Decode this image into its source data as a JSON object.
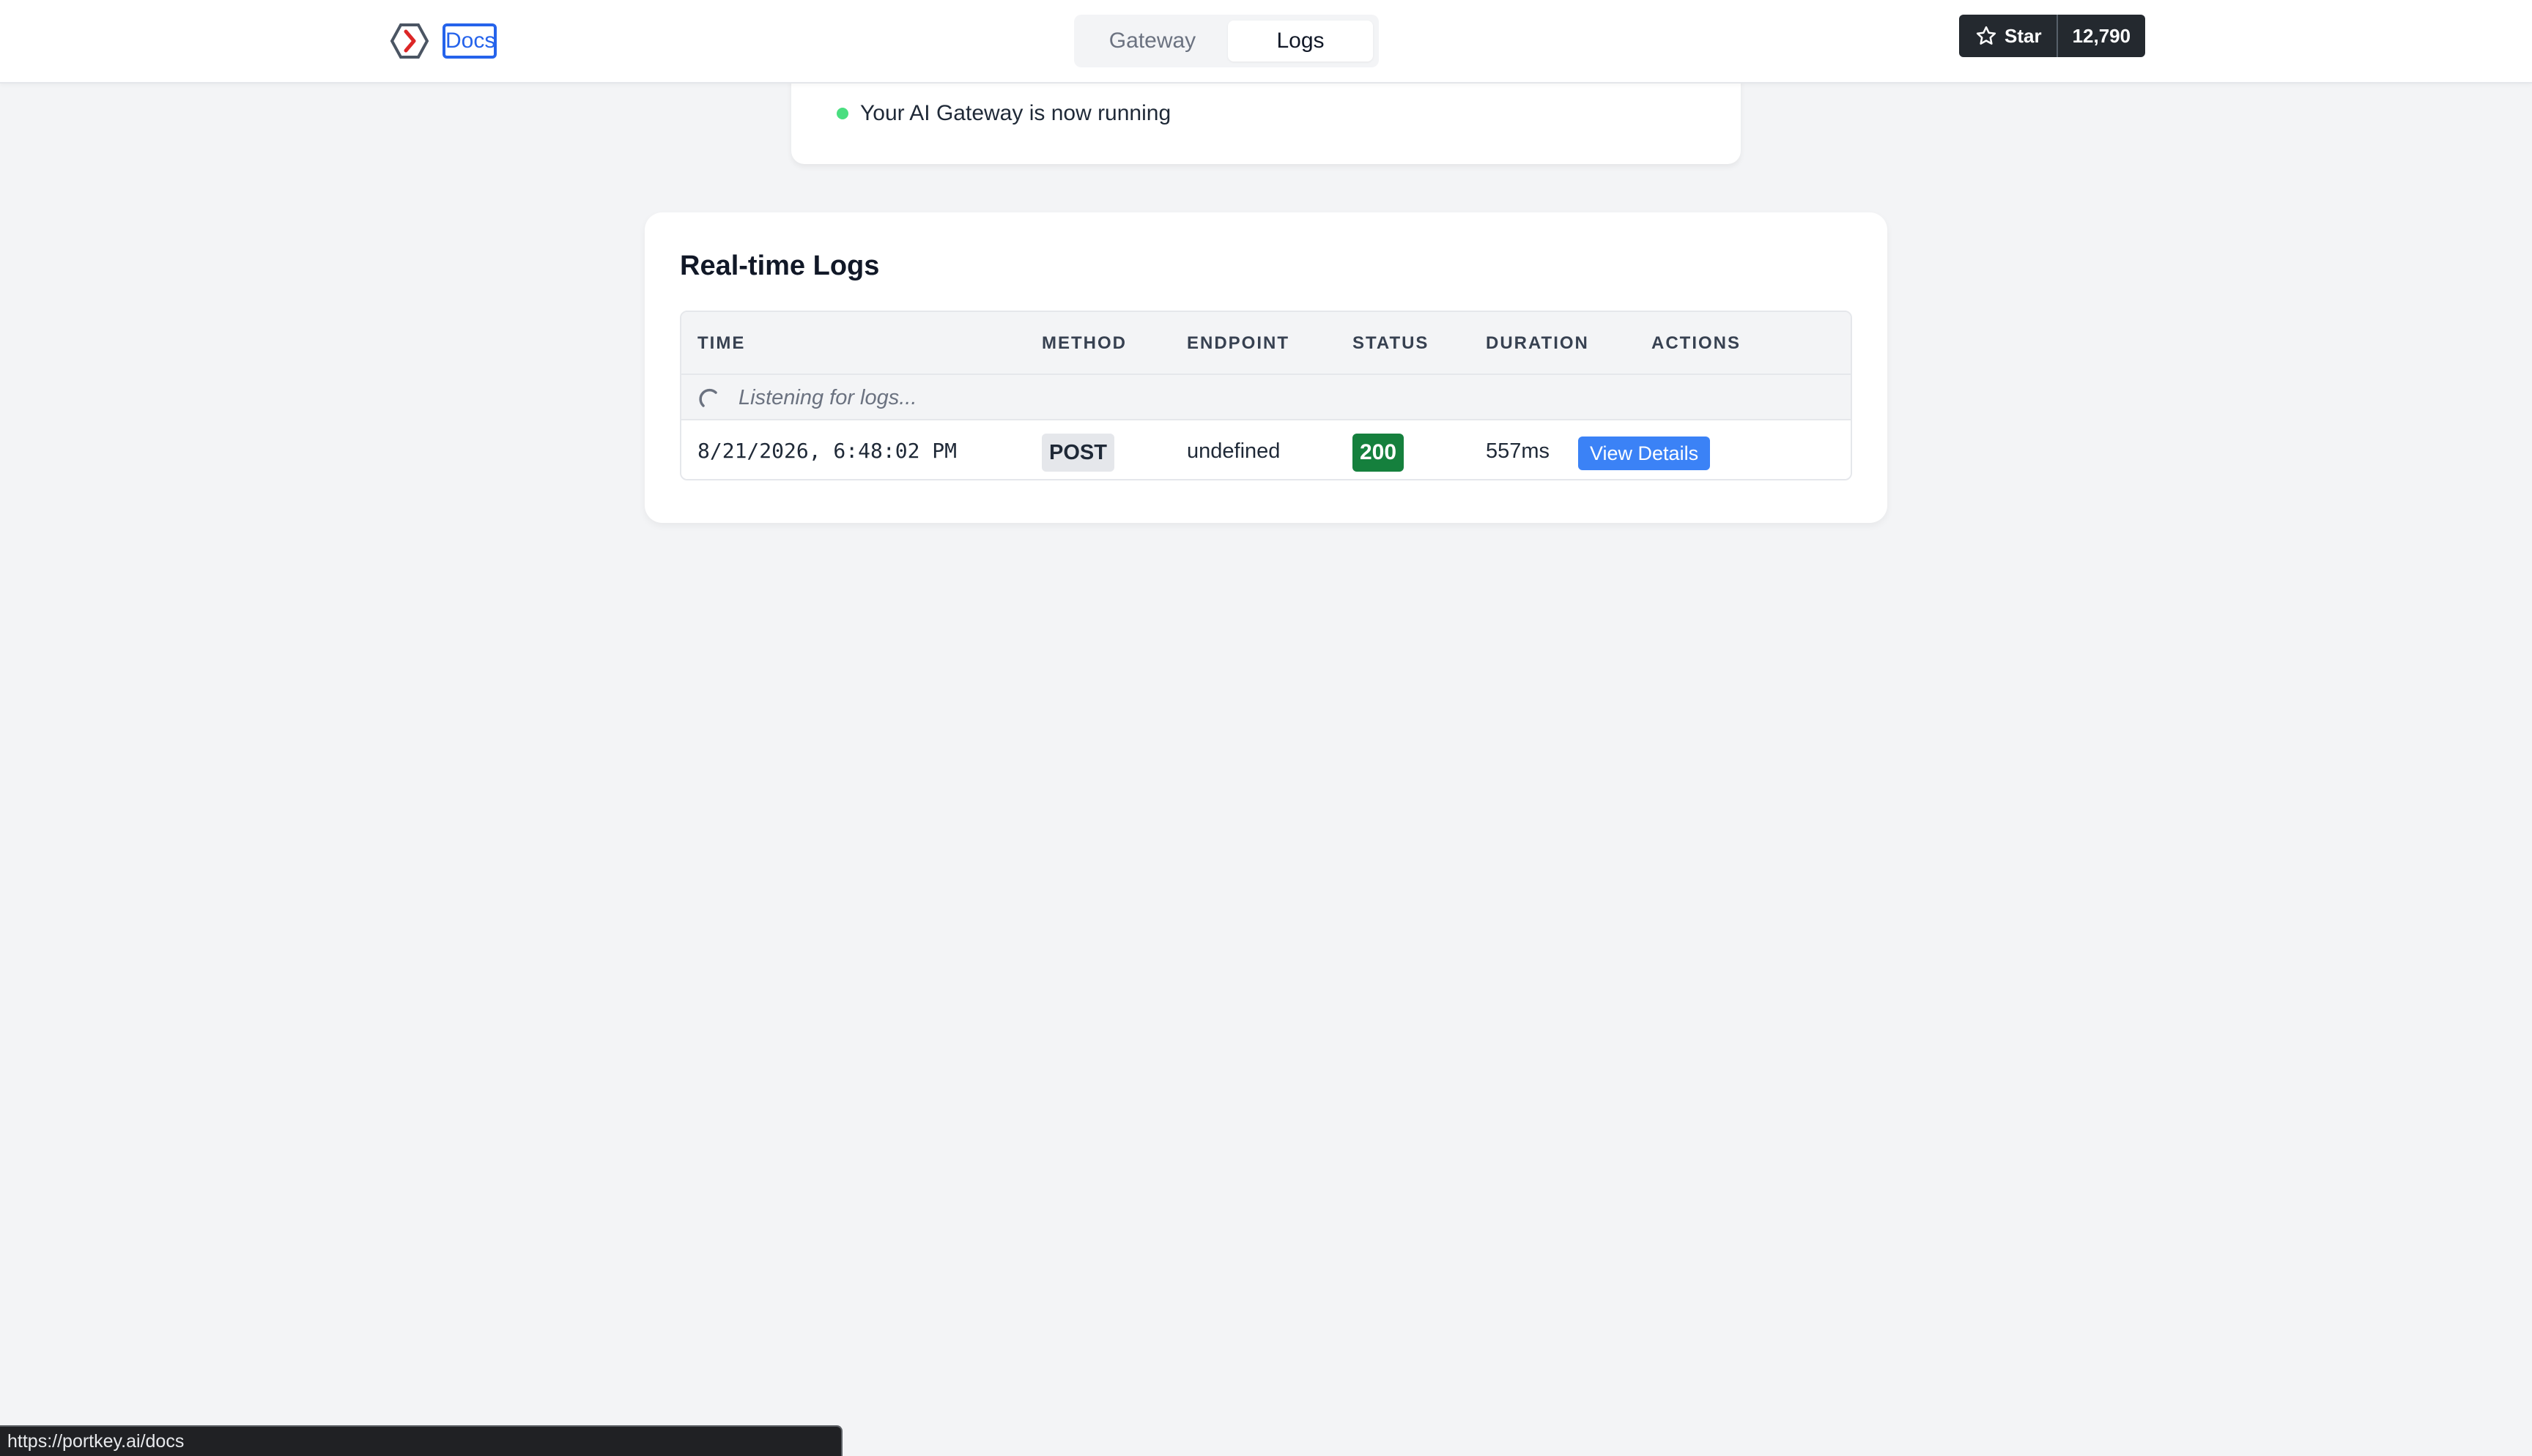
{
  "header": {
    "docs_label": "Docs",
    "tabs": [
      {
        "label": "Gateway",
        "active": false
      },
      {
        "label": "Logs",
        "active": true
      }
    ],
    "github": {
      "star_label": "Star",
      "count": "12,790"
    }
  },
  "gateway_status": {
    "message": "Your AI Gateway is now running",
    "dot_color": "#4ade80"
  },
  "logs": {
    "title": "Real-time Logs",
    "columns": [
      "TIME",
      "METHOD",
      "ENDPOINT",
      "STATUS",
      "DURATION",
      "ACTIONS"
    ],
    "listening_text": "Listening for logs...",
    "rows": [
      {
        "time": "8/21/2026, 6:48:02 PM",
        "method": "POST",
        "endpoint": "undefined",
        "status": "200",
        "duration": "557ms",
        "action_label": "View Details"
      }
    ]
  },
  "statusbar": {
    "url": "https://portkey.ai/docs"
  },
  "colors": {
    "accent": "#3b82f6",
    "status_ok": "#15803d",
    "github_bg": "#24292f"
  }
}
